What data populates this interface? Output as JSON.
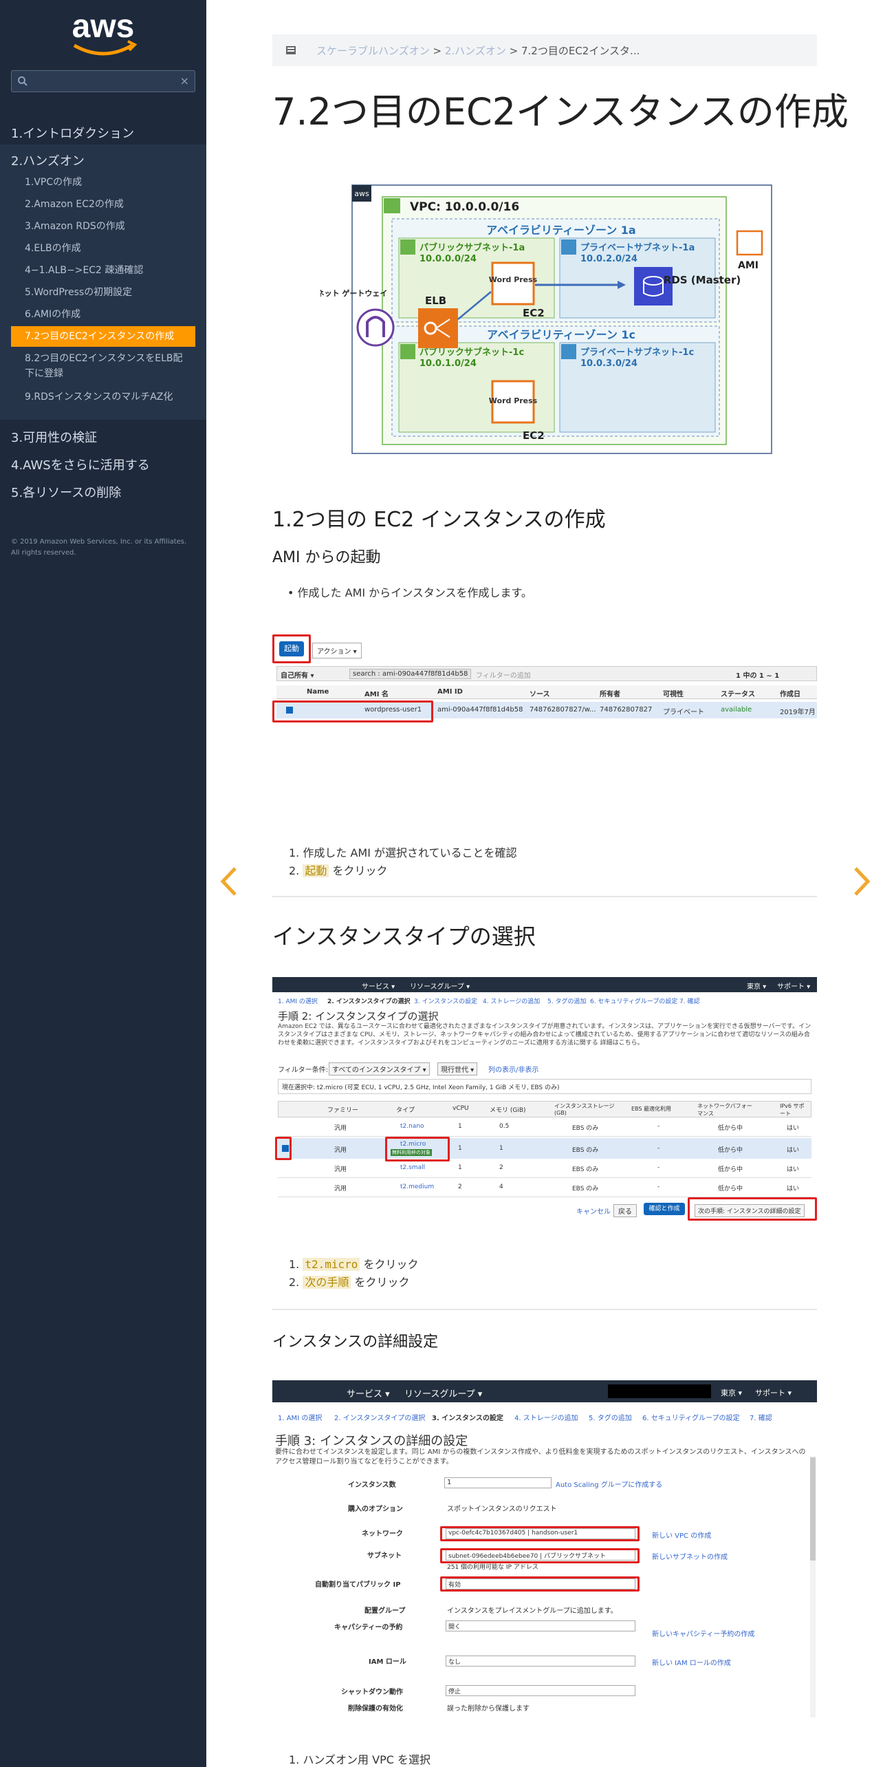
{
  "sidebar": {
    "logo_text": "aws",
    "search_placeholder": "",
    "search_clear": "×",
    "nav": [
      {
        "label": "1.イントロダクション"
      },
      {
        "label": "2.ハンズオン"
      },
      {
        "label": "3.可用性の検証"
      },
      {
        "label": "4.AWSをさらに活用する"
      },
      {
        "label": "5.各リソースの削除"
      }
    ],
    "subnav": [
      {
        "label": "1.VPCの作成"
      },
      {
        "label": "2.Amazon EC2の作成"
      },
      {
        "label": "3.Amazon RDSの作成"
      },
      {
        "label": "4.ELBの作成"
      },
      {
        "label": "4−1.ALB−>EC2 疎通確認"
      },
      {
        "label": "5.WordPressの初期設定"
      },
      {
        "label": "6.AMIの作成"
      },
      {
        "label": "7.2つ目のEC2インスタンスの作成"
      },
      {
        "label": "8.2つ目のEC2インスタンスをELB配下に登録"
      },
      {
        "label": "9.RDSインスタンスのマルチAZ化"
      }
    ],
    "copyright": "© 2019 Amazon Web Services, Inc. or its Affiliates. All rights reserved."
  },
  "breadcrumb": {
    "items": [
      "スケーラブルハンズオン",
      "2.ハンズオン"
    ],
    "current": "7.2つ目のEC2インスタ...",
    "sep": ">"
  },
  "page_title": "7.2つ目のEC2インスタンスの作成",
  "diagram": {
    "vpc": "VPC: 10.0.0.0/16",
    "az1": "アベイラビリティーゾーン 1a",
    "az2": "アベイラビリティーゾーン 1c",
    "pub1": "パブリックサブネット-1a",
    "pub1_cidr": "10.0.0.0/24",
    "pri1": "プライベートサブネット-1a",
    "pri1_cidr": "10.0.2.0/24",
    "pub2": "パブリックサブネット-1c",
    "pub2_cidr": "10.0.1.0/24",
    "pri2": "プライベートサブネット-1c",
    "pri2_cidr": "10.0.3.0/24",
    "igw": "インターネット ゲートウェイ",
    "elb": "ELB",
    "wp": "Word Press",
    "ec2": "EC2",
    "rds": "RDS (Master)",
    "ami": "AMI",
    "aws": "aws"
  },
  "section1": {
    "heading": "1.2つ目の EC2 インスタンスの作成",
    "subheading": "AMI からの起動",
    "bullet": "作成した AMI からインスタンスを作成します。",
    "steps": [
      {
        "pre": "",
        "hl": "",
        "post": "作成した AMI が選択されていることを確認"
      },
      {
        "pre": "",
        "hl": "起動",
        "post": " をクリック"
      }
    ]
  },
  "shot1": {
    "launch": "起動",
    "actions": "アクション ▾",
    "owner": "自己所有 ▾",
    "search_tag": "search : ami-090a447f8f81d4b58",
    "filter_placeholder": "フィルターの追加",
    "pager": "1 中の 1 ~ 1",
    "cols": [
      "Name",
      "AMI 名",
      "AMI ID",
      "ソース",
      "所有者",
      "可視性",
      "ステータス",
      "作成日"
    ],
    "row": [
      "",
      "wordpress-user1",
      "ami-090a447f8f81d4b58",
      "748762807827/w...",
      "748762807827",
      "プライベート",
      "available",
      "2019年7月"
    ]
  },
  "section2": {
    "heading": "インスタンスタイプの選択",
    "steps": [
      {
        "hl": "t2.micro",
        "post": " をクリック"
      },
      {
        "hl": "次の手順",
        "post": " をクリック"
      }
    ]
  },
  "shot2": {
    "services": "サービス ▾",
    "resource_groups": "リソースグループ ▾",
    "region": "東京 ▾",
    "support": "サポート ▾",
    "tabs": [
      "1. AMI の選択",
      "2. インスタンスタイプの選択",
      "3. インスタンスの設定",
      "4. ストレージの追加",
      "5. タグの追加",
      "6. セキュリティグループの設定",
      "7. 確認"
    ],
    "title": "手順 2: インスタンスタイプの選択",
    "desc": "Amazon EC2 では、異なるユースケースに合わせて最適化されたさまざまなインスタンスタイプが用意されています。インスタンスは、アプリケーションを実行できる仮想サーバーです。インスタンスタイプはさまざまな CPU、メモリ、ストレージ、ネットワークキャパシティの組み合わせによって構成されているため、使用するアプリケーションに合わせて適切なリソースの組み合わせを柔軟に選択できます。インスタンスタイプおよびそれをコンピューティングのニーズに適用する方法に関する 詳細はこちら。",
    "filter_label": "フィルター条件:",
    "filter1": "すべてのインスタンスタイプ ▾",
    "filter2": "現行世代 ▾",
    "filter3": "列の表示/非表示",
    "current": "現在選択中: t2.micro (可変 ECU, 1 vCPU, 2.5 GHz, Intel Xeon Family, 1 GiB メモリ, EBS のみ)",
    "cols": [
      "ファミリー",
      "タイプ",
      "vCPU",
      "メモリ (GiB)",
      "インスタンスストレージ (GB)",
      "EBS 最適化利用",
      "ネットワークパフォーマンス",
      "IPv6 サポート"
    ],
    "rows": [
      [
        "汎用",
        "t2.nano",
        "1",
        "0.5",
        "EBS のみ",
        "-",
        "低から中",
        "はい"
      ],
      [
        "汎用",
        "t2.micro",
        "1",
        "1",
        "EBS のみ",
        "-",
        "低から中",
        "はい"
      ],
      [
        "汎用",
        "t2.small",
        "1",
        "2",
        "EBS のみ",
        "-",
        "低から中",
        "はい"
      ],
      [
        "汎用",
        "t2.medium",
        "2",
        "4",
        "EBS のみ",
        "-",
        "低から中",
        "はい"
      ]
    ],
    "free_tier": "無料利用枠の対象",
    "cancel": "キャンセル",
    "back": "戻る",
    "review": "確認と作成",
    "next": "次の手順: インスタンスの詳細の設定"
  },
  "section3": {
    "heading": "インスタンスの詳細設定",
    "steps": [
      {
        "pre": "ハンズオン用 VPC を選択"
      }
    ]
  },
  "shot3": {
    "services": "サービス ▾",
    "resource_groups": "リソースグループ ▾",
    "region": "東京 ▾",
    "support": "サポート ▾",
    "tabs": [
      "1. AMI の選択",
      "2. インスタンスタイプの選択",
      "3. インスタンスの設定",
      "4. ストレージの追加",
      "5. タグの追加",
      "6. セキュリティグループの設定",
      "7. 確認"
    ],
    "title": "手順 3: インスタンスの詳細の設定",
    "desc": "要件に合わせてインスタンスを設定します。同じ AMI からの複数インスタンス作成や、より低料金を実現するためのスポットインスタンスのリクエスト、インスタンスへのアクセス管理ロール割り当てなどを行うことができます。",
    "fields": [
      {
        "label": "インスタンス数",
        "value": "1",
        "link": "Auto Scaling グループに作成する"
      },
      {
        "label": "購入のオプション",
        "value": "スポットインスタンスのリクエスト",
        "link": ""
      },
      {
        "label": "ネットワーク",
        "value": "vpc-0efc4c7b10367d405 | handson-user1",
        "link": "新しい VPC の作成"
      },
      {
        "label": "サブネット",
        "value": "subnet-096edeeb4b6ebee70 | パブリックサブネット",
        "link": "新しいサブネットの作成"
      },
      {
        "label": "自動割り当てパブリック IP",
        "value": "有効",
        "link": ""
      },
      {
        "label": "配置グループ",
        "value": "インスタンスをプレイスメントグループに追加します。",
        "link": ""
      },
      {
        "label": "キャパシティーの予約",
        "value": "開く",
        "link": "新しいキャパシティー予約の作成"
      },
      {
        "label": "IAM ロール",
        "value": "なし",
        "link": "新しい IAM ロールの作成"
      },
      {
        "label": "シャットダウン動作",
        "value": "停止",
        "link": ""
      },
      {
        "label": "削除保護の有効化",
        "value": "誤った削除から保護します",
        "link": ""
      }
    ],
    "subnet_note": "251 個の利用可能な IP アドレス"
  }
}
